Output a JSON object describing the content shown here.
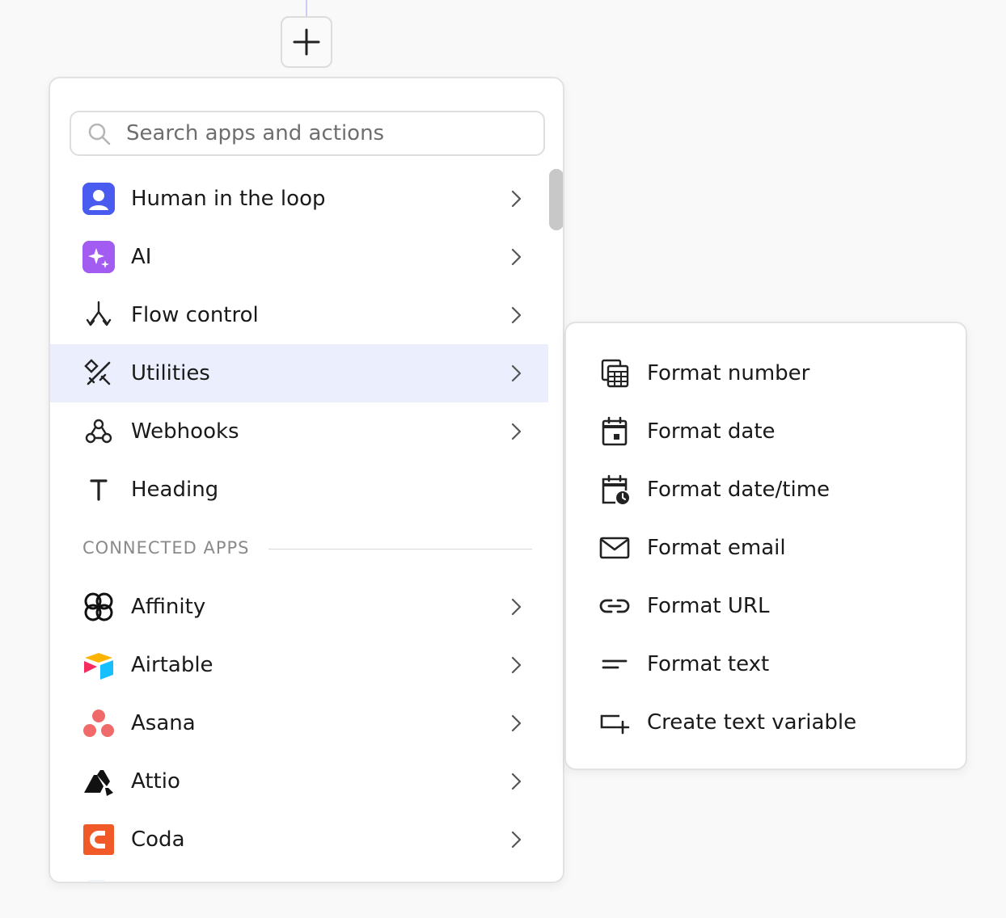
{
  "add_button": {
    "icon": "plus-icon"
  },
  "search": {
    "placeholder": "Search apps and actions",
    "value": "",
    "icon": "search-icon"
  },
  "menu": {
    "items": [
      {
        "label": "Human in the loop",
        "icon": "person-icon",
        "has_submenu": true
      },
      {
        "label": "AI",
        "icon": "sparkle-icon",
        "has_submenu": true
      },
      {
        "label": "Flow control",
        "icon": "branch-icon",
        "has_submenu": true
      },
      {
        "label": "Utilities",
        "icon": "tools-icon",
        "has_submenu": true,
        "active": true
      },
      {
        "label": "Webhooks",
        "icon": "webhook-icon",
        "has_submenu": true
      },
      {
        "label": "Heading",
        "icon": "text-t-icon",
        "has_submenu": false
      }
    ],
    "section_header": "CONNECTED APPS",
    "apps": [
      {
        "label": "Affinity",
        "icon": "affinity-logo-icon"
      },
      {
        "label": "Airtable",
        "icon": "airtable-logo-icon"
      },
      {
        "label": "Asana",
        "icon": "asana-logo-icon"
      },
      {
        "label": "Attio",
        "icon": "attio-logo-icon"
      },
      {
        "label": "Coda",
        "icon": "coda-logo-icon"
      }
    ]
  },
  "submenu": {
    "items": [
      {
        "label": "Format number",
        "icon": "calculator-icon"
      },
      {
        "label": "Format date",
        "icon": "calendar-icon"
      },
      {
        "label": "Format date/time",
        "icon": "calendar-clock-icon"
      },
      {
        "label": "Format email",
        "icon": "envelope-icon"
      },
      {
        "label": "Format URL",
        "icon": "link-icon"
      },
      {
        "label": "Format text",
        "icon": "text-lines-icon"
      },
      {
        "label": "Create text variable",
        "icon": "variable-add-icon"
      }
    ]
  },
  "colors": {
    "active_row": "#eaeefd",
    "human_loop": "#4a5cf0",
    "ai": "#a25cf2",
    "coda": "#f05a28",
    "asana": "#f06a6a",
    "airtable_yellow": "#fcb400",
    "airtable_blue": "#18bfff",
    "airtable_red": "#f82b60"
  }
}
